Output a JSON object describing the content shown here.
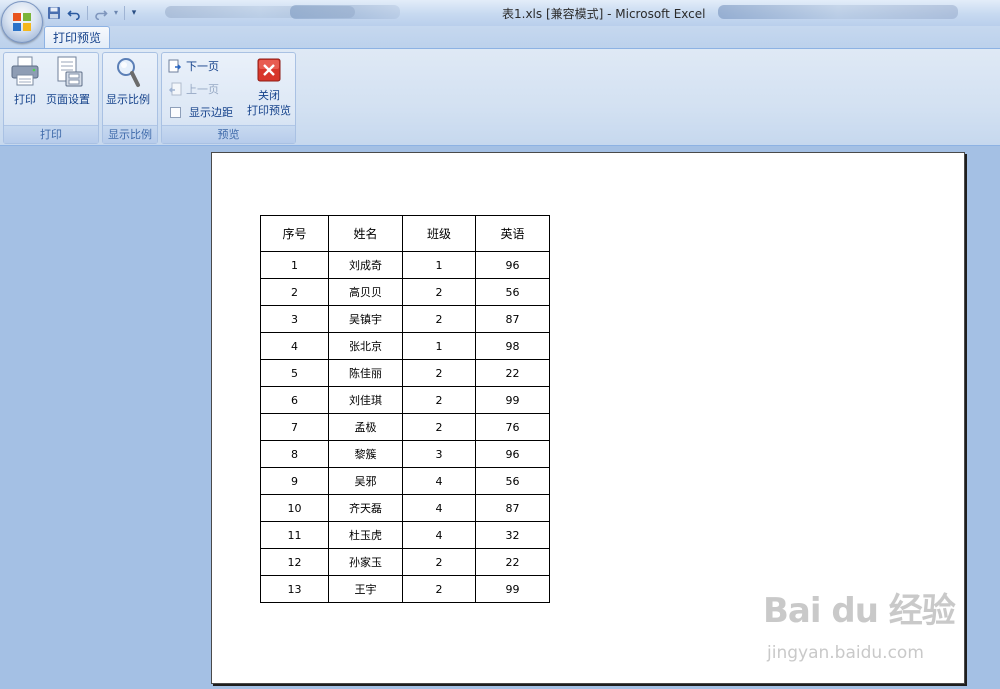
{
  "window": {
    "title": "表1.xls  [兼容模式] - Microsoft Excel"
  },
  "quick_access": {
    "icons": [
      "save-icon",
      "undo-icon",
      "redo-icon",
      "customize-dropdown-icon"
    ]
  },
  "ribbon": {
    "active_tab": "打印预览",
    "groups": [
      {
        "label": "打印",
        "buttons": [
          {
            "label": "打印",
            "icon": "printer-icon"
          },
          {
            "label": "页面设置",
            "icon": "page-setup-icon"
          }
        ]
      },
      {
        "label": "显示比例",
        "buttons": [
          {
            "label": "显示比例",
            "icon": "zoom-icon"
          }
        ]
      },
      {
        "label": "预览",
        "small_buttons": [
          {
            "label": "下一页",
            "icon": "next-page-icon",
            "enabled": true
          },
          {
            "label": "上一页",
            "icon": "prev-page-icon",
            "enabled": false
          }
        ],
        "checkbox": {
          "label": "显示边距",
          "checked": false
        },
        "close_button": {
          "label_line1": "关闭",
          "label_line2": "打印预览",
          "icon": "close-icon"
        }
      }
    ]
  },
  "table": {
    "headers": [
      "序号",
      "姓名",
      "班级",
      "英语"
    ],
    "rows": [
      [
        "1",
        "刘成奇",
        "1",
        "96"
      ],
      [
        "2",
        "高贝贝",
        "2",
        "56"
      ],
      [
        "3",
        "吴镇宇",
        "2",
        "87"
      ],
      [
        "4",
        "张北京",
        "1",
        "98"
      ],
      [
        "5",
        "陈佳丽",
        "2",
        "22"
      ],
      [
        "6",
        "刘佳琪",
        "2",
        "99"
      ],
      [
        "7",
        "孟极",
        "2",
        "76"
      ],
      [
        "8",
        "黎簇",
        "3",
        "96"
      ],
      [
        "9",
        "吴邪",
        "4",
        "56"
      ],
      [
        "10",
        "齐天磊",
        "4",
        "87"
      ],
      [
        "11",
        "杜玉虎",
        "4",
        "32"
      ],
      [
        "12",
        "孙家玉",
        "2",
        "22"
      ],
      [
        "13",
        "王宇",
        "2",
        "99"
      ]
    ]
  },
  "watermark": {
    "logo": "Bai du 经验",
    "url": "jingyan.baidu.com"
  }
}
